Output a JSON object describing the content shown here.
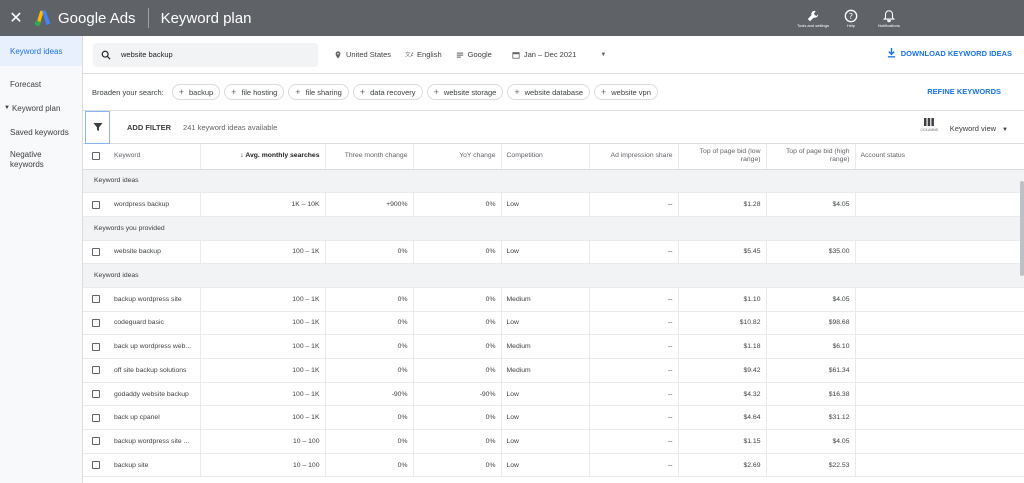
{
  "topbar": {
    "brand": "Google Ads",
    "title": "Keyword plan",
    "tools": [
      {
        "icon": "wrench-icon",
        "label": "Tools and settings"
      },
      {
        "icon": "help-icon",
        "label": "Help"
      },
      {
        "icon": "bell-icon",
        "label": "Notifications"
      }
    ]
  },
  "sidebar": {
    "items": [
      {
        "label": "Keyword ideas"
      },
      {
        "label": "Forecast"
      },
      {
        "label": "Keyword plan"
      },
      {
        "label": "Saved keywords"
      },
      {
        "label": "Negative keywords"
      }
    ]
  },
  "search": {
    "query": "website backup",
    "location": "United States",
    "language": "English",
    "network": "Google",
    "date_range": "Jan – Dec 2021",
    "download_label": "DOWNLOAD KEYWORD IDEAS"
  },
  "broaden": {
    "label": "Broaden your search:",
    "chips": [
      "backup",
      "file hosting",
      "file sharing",
      "data recovery",
      "website storage",
      "website database",
      "website vpn"
    ],
    "refine_label": "REFINE KEYWORDS"
  },
  "filterbar": {
    "add_filter": "ADD FILTER",
    "available": "241 keyword ideas available",
    "columns_label": "COLUMNS",
    "view_label": "Keyword view"
  },
  "table": {
    "headers": {
      "keyword": "Keyword",
      "avg": "Avg. monthly searches",
      "three_month": "Three month change",
      "yoy": "YoY change",
      "competition": "Competition",
      "ad_share": "Ad impression share",
      "bid_low": "Top of page bid (low range)",
      "bid_high": "Top of page bid (high range)",
      "status": "Account status"
    },
    "sections": {
      "ideas1": "Keyword ideas",
      "provided": "Keywords you provided",
      "ideas2": "Keyword ideas"
    },
    "rows": [
      {
        "kw": "wordpress backup",
        "avg": "1K – 10K",
        "tm": "+900%",
        "yoy": "0%",
        "comp": "Low",
        "ad": "--",
        "low": "$1.28",
        "high": "$4.05"
      },
      {
        "kw": "website backup",
        "avg": "100 – 1K",
        "tm": "0%",
        "yoy": "0%",
        "comp": "Low",
        "ad": "--",
        "low": "$5.45",
        "high": "$35.00"
      },
      {
        "kw": "backup wordpress site",
        "avg": "100 – 1K",
        "tm": "0%",
        "yoy": "0%",
        "comp": "Medium",
        "ad": "--",
        "low": "$1.10",
        "high": "$4.05"
      },
      {
        "kw": "codeguard basic",
        "avg": "100 – 1K",
        "tm": "0%",
        "yoy": "0%",
        "comp": "Low",
        "ad": "--",
        "low": "$10.82",
        "high": "$98.68"
      },
      {
        "kw": "back up wordpress web...",
        "avg": "100 – 1K",
        "tm": "0%",
        "yoy": "0%",
        "comp": "Medium",
        "ad": "--",
        "low": "$1.18",
        "high": "$6.10"
      },
      {
        "kw": "off site backup solutions",
        "avg": "100 – 1K",
        "tm": "0%",
        "yoy": "0%",
        "comp": "Medium",
        "ad": "--",
        "low": "$9.42",
        "high": "$61.34"
      },
      {
        "kw": "godaddy website backup",
        "avg": "100 – 1K",
        "tm": "-90%",
        "yoy": "-90%",
        "comp": "Low",
        "ad": "--",
        "low": "$4.32",
        "high": "$16.38"
      },
      {
        "kw": "back up cpanel",
        "avg": "100 – 1K",
        "tm": "0%",
        "yoy": "0%",
        "comp": "Low",
        "ad": "--",
        "low": "$4.64",
        "high": "$31.12"
      },
      {
        "kw": "backup wordpress site ...",
        "avg": "10 – 100",
        "tm": "0%",
        "yoy": "0%",
        "comp": "Low",
        "ad": "--",
        "low": "$1.15",
        "high": "$4.05"
      },
      {
        "kw": "backup site",
        "avg": "10 – 100",
        "tm": "0%",
        "yoy": "0%",
        "comp": "Low",
        "ad": "--",
        "low": "$2.69",
        "high": "$22.53"
      }
    ]
  }
}
